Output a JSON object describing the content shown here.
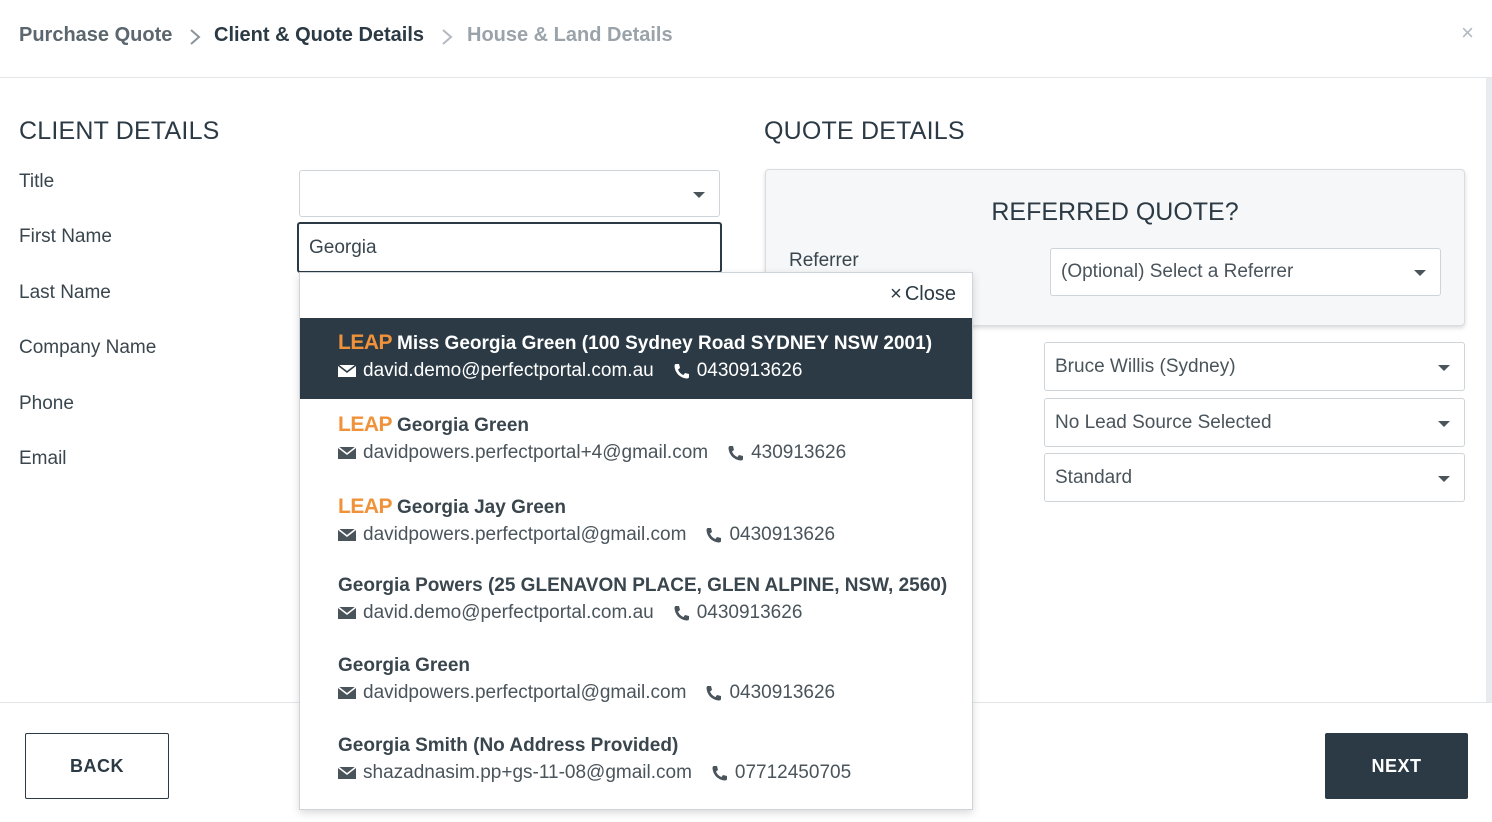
{
  "breadcrumb": {
    "step1": "Purchase Quote",
    "step2": "Client & Quote Details",
    "step3": "House & Land Details"
  },
  "close_symbol": "×",
  "client_details": {
    "title": "CLIENT DETAILS",
    "labels": {
      "title": "Title",
      "first_name": "First Name",
      "last_name": "Last Name",
      "company_name": "Company Name",
      "phone": "Phone",
      "email": "Email"
    },
    "title_value": "",
    "first_name_value": "Georgia"
  },
  "quote_details": {
    "title": "QUOTE DETAILS",
    "referred_title": "REFERRED QUOTE?",
    "referrer_label": "Referrer",
    "referrer_select": "(Optional) Select a Referrer",
    "consultant_select": "Bruce Willis (Sydney)",
    "lead_source_select": "No Lead Source Selected",
    "quote_type_select": "Standard"
  },
  "autocomplete": {
    "close_label": "Close",
    "close_icon": "×",
    "leap_badge": "LEAP",
    "items": [
      {
        "leap": true,
        "name": "Miss Georgia Green (100 Sydney Road SYDNEY NSW 2001)",
        "email": "david.demo@perfectportal.com.au",
        "phone": "0430913626",
        "highlighted": true
      },
      {
        "leap": true,
        "name": "Georgia Green",
        "email": "davidpowers.perfectportal+4@gmail.com",
        "phone": "430913626"
      },
      {
        "leap": true,
        "name": "Georgia Jay Green",
        "email": "davidpowers.perfectportal@gmail.com",
        "phone": "0430913626"
      },
      {
        "leap": false,
        "name": "Georgia Powers (25 GLENAVON PLACE, GLEN ALPINE, NSW, 2560)",
        "email": "david.demo@perfectportal.com.au",
        "phone": "0430913626"
      },
      {
        "leap": false,
        "name": "Georgia Green",
        "email": "davidpowers.perfectportal@gmail.com",
        "phone": "0430913626"
      },
      {
        "leap": false,
        "name": "Georgia Smith (No Address Provided)",
        "email": "shazadnasim.pp+gs-11-08@gmail.com",
        "phone": "07712450705"
      }
    ]
  },
  "footer": {
    "back_label": "BACK",
    "next_label": "NEXT"
  },
  "colors": {
    "primary": "#2b3a44",
    "leap_orange": "#f0923a"
  },
  "icons": {
    "email": "envelope-icon",
    "phone": "phone-icon",
    "chevron": "chevron-right-icon",
    "caret": "caret-down-icon"
  }
}
